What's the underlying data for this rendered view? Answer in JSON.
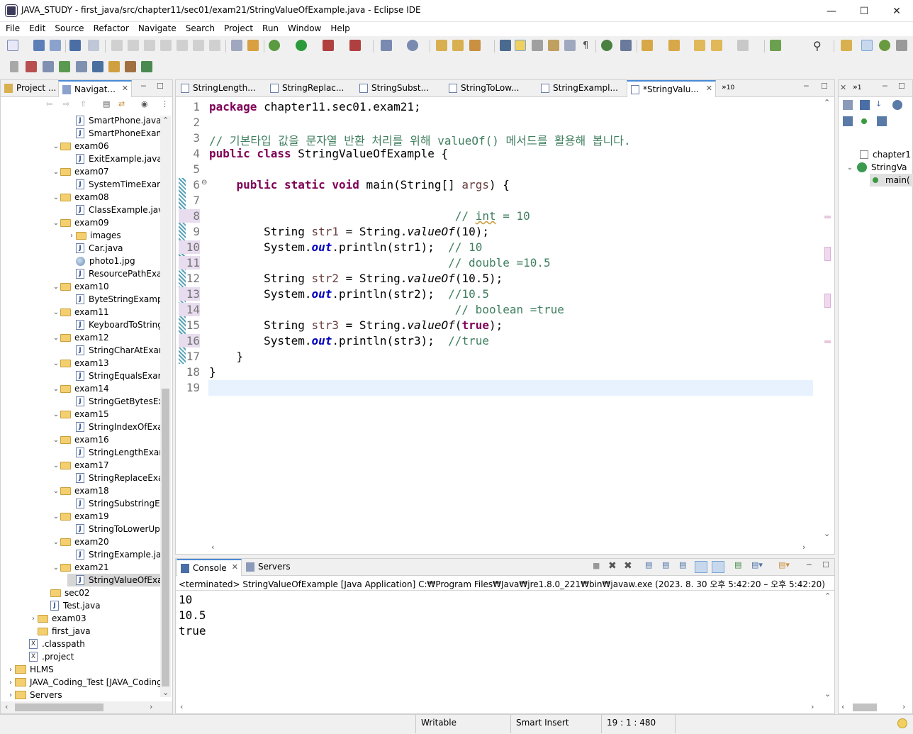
{
  "window": {
    "title": "JAVA_STUDY - first_java/src/chapter11/sec01/exam21/StringValueOfExample.java - Eclipse IDE"
  },
  "menu": [
    "File",
    "Edit",
    "Source",
    "Refactor",
    "Navigate",
    "Search",
    "Project",
    "Run",
    "Window",
    "Help"
  ],
  "left_panel": {
    "tabs": [
      {
        "label": "Project ..."
      },
      {
        "label": "Navigat..."
      }
    ],
    "tree": [
      {
        "label": "SmartPhone.java",
        "kind": "java",
        "indent": 2
      },
      {
        "label": "SmartPhoneExamp",
        "kind": "java",
        "indent": 2
      },
      {
        "label": "exam06",
        "kind": "folder",
        "indent": 1,
        "open": true
      },
      {
        "label": "ExitExample.java",
        "kind": "java",
        "indent": 2
      },
      {
        "label": "exam07",
        "kind": "folder",
        "indent": 1,
        "open": true
      },
      {
        "label": "SystemTimeExamp",
        "kind": "java",
        "indent": 2
      },
      {
        "label": "exam08",
        "kind": "folder",
        "indent": 1,
        "open": true
      },
      {
        "label": "ClassExample.java",
        "kind": "java",
        "indent": 2
      },
      {
        "label": "exam09",
        "kind": "folder",
        "indent": 1,
        "open": true
      },
      {
        "label": "images",
        "kind": "folder",
        "indent": 2,
        "open": false
      },
      {
        "label": "Car.java",
        "kind": "java",
        "indent": 2
      },
      {
        "label": "photo1.jpg",
        "kind": "image",
        "indent": 2
      },
      {
        "label": "ResourcePathExam",
        "kind": "java",
        "indent": 2
      },
      {
        "label": "exam10",
        "kind": "folder",
        "indent": 1,
        "open": true
      },
      {
        "label": "ByteStringExample",
        "kind": "java",
        "indent": 2
      },
      {
        "label": "exam11",
        "kind": "folder",
        "indent": 1,
        "open": true
      },
      {
        "label": "KeyboardToStringE",
        "kind": "java",
        "indent": 2
      },
      {
        "label": "exam12",
        "kind": "folder",
        "indent": 1,
        "open": true
      },
      {
        "label": "StringCharAtExam",
        "kind": "java",
        "indent": 2
      },
      {
        "label": "exam13",
        "kind": "folder",
        "indent": 1,
        "open": true
      },
      {
        "label": "StringEqualsExamp",
        "kind": "java",
        "indent": 2
      },
      {
        "label": "exam14",
        "kind": "folder",
        "indent": 1,
        "open": true
      },
      {
        "label": "StringGetBytesExan",
        "kind": "java",
        "indent": 2
      },
      {
        "label": "exam15",
        "kind": "folder",
        "indent": 1,
        "open": true
      },
      {
        "label": "StringIndexOfExam",
        "kind": "java",
        "indent": 2
      },
      {
        "label": "exam16",
        "kind": "folder",
        "indent": 1,
        "open": true
      },
      {
        "label": "StringLengthExam",
        "kind": "java",
        "indent": 2
      },
      {
        "label": "exam17",
        "kind": "folder",
        "indent": 1,
        "open": true
      },
      {
        "label": "StringReplaceExam",
        "kind": "java",
        "indent": 2
      },
      {
        "label": "exam18",
        "kind": "folder",
        "indent": 1,
        "open": true
      },
      {
        "label": "StringSubstringExa",
        "kind": "java",
        "indent": 2
      },
      {
        "label": "exam19",
        "kind": "folder",
        "indent": 1,
        "open": true
      },
      {
        "label": "StringToLowerUpp",
        "kind": "java",
        "indent": 2
      },
      {
        "label": "exam20",
        "kind": "folder",
        "indent": 1,
        "open": true
      },
      {
        "label": "StringExample.java",
        "kind": "java",
        "indent": 2
      },
      {
        "label": "exam21",
        "kind": "folder",
        "indent": 1,
        "open": true
      },
      {
        "label": "StringValueOfExam",
        "kind": "java",
        "indent": 2,
        "selected": true
      },
      {
        "label": "sec02",
        "kind": "folder",
        "indent": 0
      },
      {
        "label": "Test.java",
        "kind": "java",
        "indent": 0
      },
      {
        "label": "exam03",
        "kind": "folder",
        "indent": -1,
        "open": false
      },
      {
        "label": "first_java",
        "kind": "folder",
        "indent": -1
      },
      {
        "label": ".classpath",
        "kind": "xml",
        "indent": -2
      },
      {
        "label": ".project",
        "kind": "xml",
        "indent": -2
      },
      {
        "label": "HLMS",
        "kind": "project",
        "indent": -3,
        "open": false
      },
      {
        "label": "JAVA_Coding_Test [JAVA_Coding",
        "kind": "project",
        "indent": -3,
        "open": false
      },
      {
        "label": "Servers",
        "kind": "project",
        "indent": -3,
        "open": false
      }
    ]
  },
  "editor": {
    "tabs": [
      {
        "label": "StringLength..."
      },
      {
        "label": "StringReplac..."
      },
      {
        "label": "StringSubst..."
      },
      {
        "label": "StringToLow..."
      },
      {
        "label": "StringExampl..."
      },
      {
        "label": "*StringValu...",
        "active": true
      }
    ],
    "overflow_count": "10",
    "line_numbers": [
      "1",
      "2",
      "3",
      "4",
      "5",
      "6",
      "7",
      "8",
      "9",
      "10",
      "11",
      "12",
      "13",
      "14",
      "15",
      "16",
      "17",
      "18",
      "19"
    ],
    "code": {
      "l1_kw": "package",
      "l1_rest": " chapter11.sec01.exam21;",
      "l3_comment": "// 기본타입 값을 문자열 반환 처리를 위해 valueOf() 메서드를 활용해 봅니다.",
      "l4_kw": "public class",
      "l4_rest": " StringValueOfExample {",
      "l6_kw": "public static void",
      "l6_main": " main(String[] ",
      "l6_args": "args",
      "l6_end": ") {",
      "l8_comment_a": "// ",
      "l8_comment_b": "int",
      "l8_comment_c": " = 10",
      "l9_a": "String ",
      "l9_var": "str1",
      "l9_b": " = String.",
      "l9_method": "valueOf",
      "l9_c": "(10);",
      "l10_a": "System.",
      "l10_out": "out",
      "l10_b": ".println(str1);  ",
      "l10_comment": "// 10",
      "l11_comment": "// double =10.5",
      "l12_var": "str2",
      "l12_c": "(10.5);",
      "l13_b": ".println(str2);  ",
      "l13_comment": "//10.5",
      "l14_comment": "// boolean =true",
      "l15_var": "str3",
      "l15_true": "true",
      "l15_c": ");",
      "l16_b": ".println(str3);  ",
      "l16_comment": "//true",
      "l17": "}",
      "l18": "}"
    }
  },
  "console": {
    "tabs": [
      {
        "label": "Console"
      },
      {
        "label": "Servers"
      }
    ],
    "status": "<terminated> StringValueOfExample [Java Application] C:₩Program Files₩Java₩jre1.8.0_221₩bin₩javaw.exe  (2023. 8. 30 오후 5:42:20 – 오후 5:42:20)",
    "output": [
      "10",
      "10.5",
      "true"
    ]
  },
  "outline": {
    "tab_overflow": "1",
    "items": [
      {
        "label": "chapter1"
      },
      {
        "label": "StringVa"
      },
      {
        "label": "main("
      }
    ]
  },
  "statusbar": {
    "writable": "Writable",
    "insert": "Smart Insert",
    "position": "19 : 1 : 480"
  },
  "colors": {
    "keyword": "#7f0055",
    "comment": "#3f7f5f",
    "field": "#0000c0",
    "accent": "#4a8ad6"
  }
}
